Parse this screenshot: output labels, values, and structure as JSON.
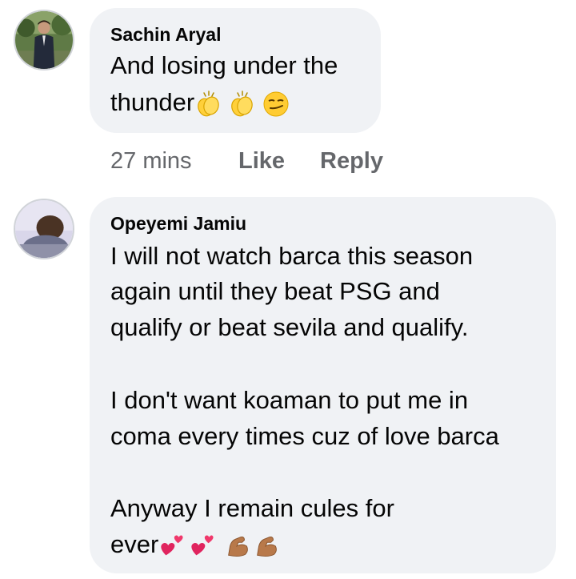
{
  "comments": [
    {
      "author": "Sachin Aryal",
      "lines": [
        "And losing under the",
        "thunder"
      ],
      "emojis": [
        "clapping-hands",
        "clapping-hands",
        "smirking-face"
      ],
      "actions": {
        "time": "27 mins",
        "like": "Like",
        "reply": "Reply"
      }
    },
    {
      "author": "Opeyemi Jamiu",
      "lines": [
        "I will not watch barca this season",
        "again until they beat PSG and",
        "qualify or beat sevila and qualify.",
        "I don't want koaman to put me in",
        "coma every times cuz of love barca",
        "Anyway I remain cules for",
        "ever"
      ],
      "emojis": [
        "two-hearts",
        "two-hearts",
        "flexed-biceps",
        "flexed-biceps"
      ]
    }
  ],
  "colors": {
    "bubble": "#f0f2f5",
    "text": "#050505",
    "muted": "#65676b"
  }
}
